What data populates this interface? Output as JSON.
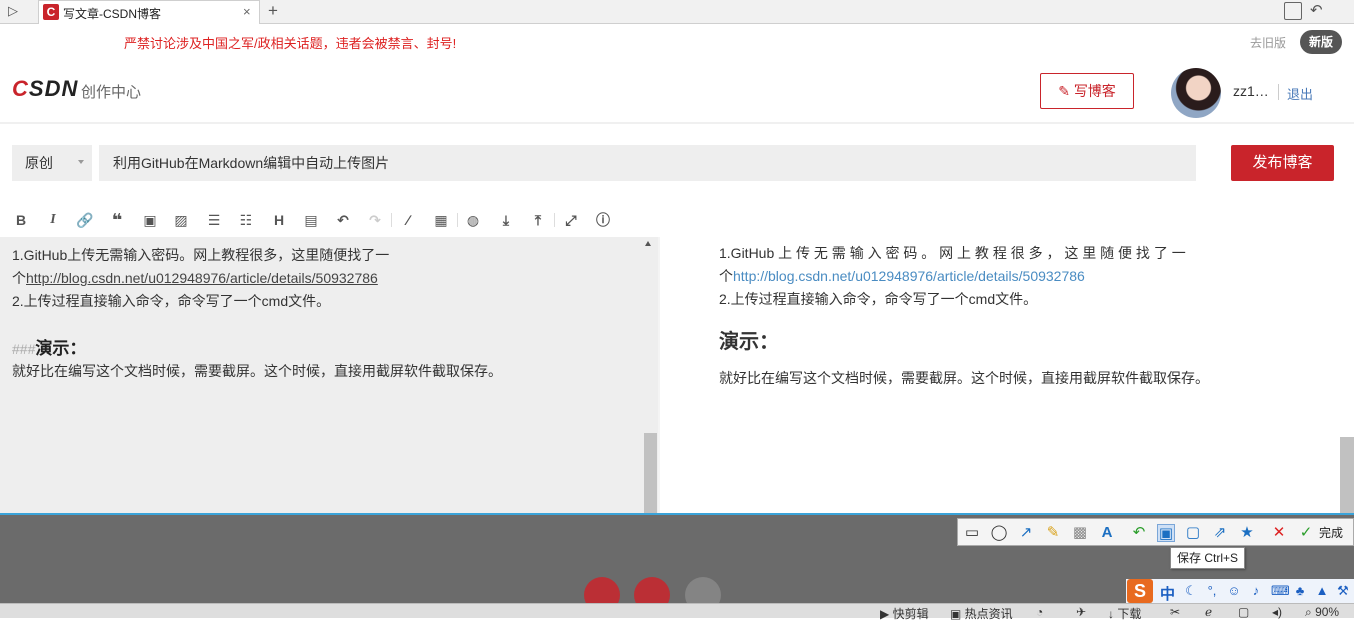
{
  "browser": {
    "tab_title": "写文章-CSDN博客",
    "tab_favicon": "C",
    "tab_close": "×",
    "new_tab": "+",
    "sidebar_toggle": "▷",
    "undo_close_icon": "↶"
  },
  "notice": {
    "text": "严禁讨论涉及中国之军/政相关话题，违者会被禁言、封号!",
    "old_version": "去旧版",
    "new_version": "新版"
  },
  "header": {
    "logo_c": "C",
    "logo_rest": "SDN",
    "center": "创作中心",
    "write_blog": "写博客",
    "username": "zz1…",
    "logout": "退出"
  },
  "title_row": {
    "type": "原创",
    "title": "利用GitHub在Markdown编辑中自动上传图片",
    "publish": "发布博客"
  },
  "toolbar": {
    "icons": [
      "bold-icon",
      "italic-icon",
      "link-icon",
      "quote-icon",
      "code-icon",
      "image-icon",
      "ordered-list-icon",
      "unordered-list-icon",
      "heading-icon",
      "hr-icon",
      "undo-icon",
      "redo-icon",
      "pen-icon",
      "template-icon",
      "globe-icon",
      "import-icon",
      "export-icon",
      "fullscreen-icon",
      "help-icon"
    ]
  },
  "editor": {
    "line1": "1.GitHub上传无需输入密码。网上教程很多，这里随便找了一",
    "line2_prefix": "个",
    "line2_url": "http://blog.csdn.net/u012948976/article/details/50932786",
    "line3": "2.上传过程直接输入命令，命令写了一个cmd文件。",
    "heading_hashes": "###",
    "heading_text": "演示：",
    "line5": "就好比在编写这个文档时候，需要截屏。这个时候，直接用截屏软件截取保存。"
  },
  "preview": {
    "line1": "1.GitHub 上 传 无 需 输 入 密 码 。 网 上 教 程 很 多 ， 这 里 随 便 找 了 一",
    "line2_prefix": "个",
    "line2_url": "http://blog.csdn.net/u012948976/article/details/50932786",
    "line3": "2.上传过程直接输入命令，命令写了一个cmd文件。",
    "heading": "演示：",
    "line5": "就好比在编写这个文档时候，需要截屏。这个时候，直接用截屏软件截取保存。"
  },
  "snip_tool": {
    "done": "完成",
    "tooltip": "保存 Ctrl+S"
  },
  "ime": {
    "logo": "S",
    "mode": "中"
  },
  "statusbar": {
    "quick_clip": "快剪辑",
    "hot_news": "热点资讯",
    "download": "下载",
    "zoom": "90%"
  },
  "colors": {
    "brand_red": "#c9242b",
    "link_blue": "#4a8cc2",
    "overlay_gray": "#6b6b6b"
  }
}
